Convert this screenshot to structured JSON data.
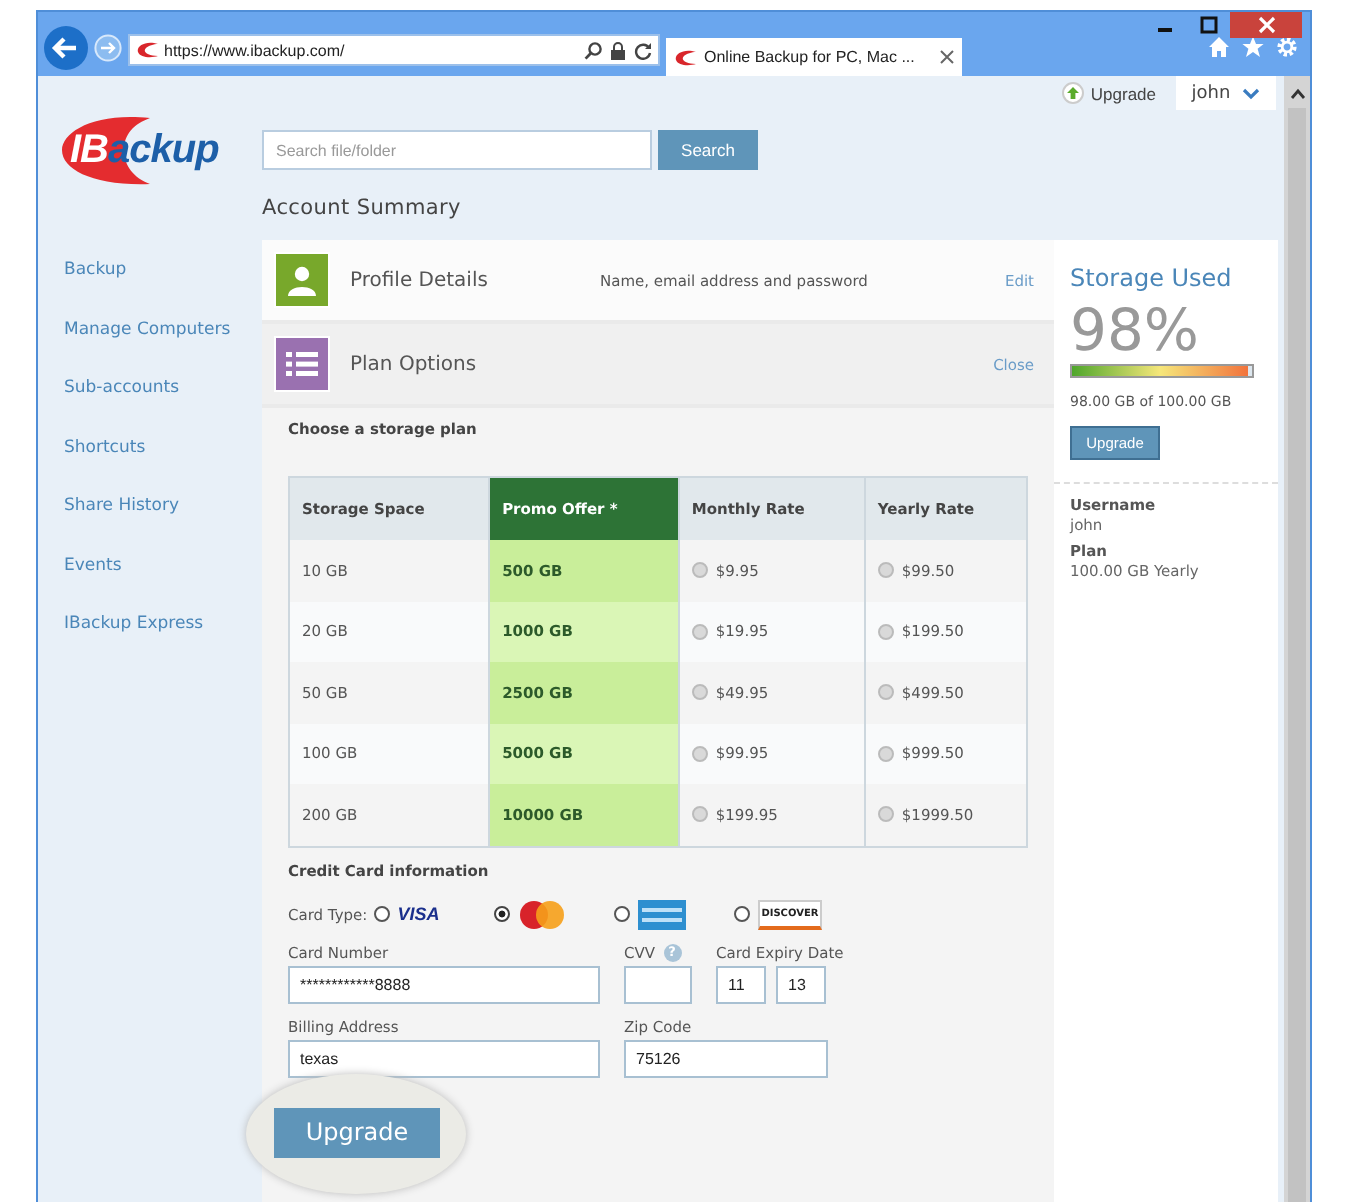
{
  "browser": {
    "address": "https://www.ibackup.com/",
    "tabs": [
      {
        "label": "Online Backup for PC, Mac ...",
        "selected": true
      }
    ]
  },
  "header": {
    "upgrade_link": "Upgrade",
    "user_menu": "john",
    "logo": {
      "prefix": "IB",
      "rest": "ackup"
    },
    "search": {
      "placeholder": "Search file/folder",
      "button": "Search"
    },
    "page_title": "Account Summary"
  },
  "sidebar": {
    "items": [
      {
        "label": "Backup"
      },
      {
        "label": "Manage Computers"
      },
      {
        "label": "Sub-accounts"
      },
      {
        "label": "Shortcuts"
      },
      {
        "label": "Share History"
      },
      {
        "label": "Events"
      },
      {
        "label": "IBackup Express"
      }
    ]
  },
  "sections": [
    {
      "kind": "profile",
      "title": "Profile Details",
      "description": "Name, email address and password",
      "action": "Edit"
    },
    {
      "kind": "plan",
      "title": "Plan Options",
      "action": "Close"
    }
  ],
  "plan": {
    "heading": "Choose a storage plan",
    "columns": [
      "Storage Space",
      "Promo Offer *",
      "Monthly Rate",
      "Yearly Rate"
    ],
    "rows": [
      {
        "space": "10 GB",
        "promo": "500 GB",
        "monthly": {
          "price": "$9.95",
          "selected": false
        },
        "yearly": {
          "price": "$99.50",
          "selected": false
        }
      },
      {
        "space": "20 GB",
        "promo": "1000 GB",
        "monthly": {
          "price": "$19.95",
          "selected": false
        },
        "yearly": {
          "price": "$199.50",
          "selected": false
        }
      },
      {
        "space": "50 GB",
        "promo": "2500 GB",
        "monthly": {
          "price": "$49.95",
          "selected": false
        },
        "yearly": {
          "price": "$499.50",
          "selected": false
        }
      },
      {
        "space": "100 GB",
        "promo": "5000 GB",
        "monthly": {
          "price": "$99.95",
          "selected": false
        },
        "yearly": {
          "price": "$999.50",
          "selected": false
        }
      },
      {
        "space": "200 GB",
        "promo": "10000 GB",
        "monthly": {
          "price": "$199.95",
          "selected": false
        },
        "yearly": {
          "price": "$1999.50",
          "selected": false
        }
      }
    ]
  },
  "credit_card": {
    "heading": "Credit Card information",
    "card_type_label": "Card Type:",
    "card_types": [
      {
        "kind": "visa",
        "label": "VISA",
        "selected": false
      },
      {
        "kind": "mastercard",
        "selected": true
      },
      {
        "kind": "amex",
        "selected": false
      },
      {
        "kind": "discover",
        "label": "DISCOVER",
        "selected": false
      }
    ],
    "card_number": {
      "label": "Card Number",
      "value": "************8888"
    },
    "cvv": {
      "label": "CVV",
      "help": "?"
    },
    "expiry": {
      "label": "Card Expiry Date",
      "month": "11",
      "year": "13"
    },
    "billing_address": {
      "label": "Billing Address",
      "value": "texas"
    },
    "zip": {
      "label": "Zip Code",
      "value": "75126"
    },
    "submit": "Upgrade"
  },
  "storage": {
    "title": "Storage Used",
    "percent": "98%",
    "level": 0.98,
    "detail": "98.00 GB of 100.00 GB",
    "button": "Upgrade",
    "username_label": "Username",
    "username": "john",
    "plan_label": "Plan",
    "plan_value": "100.00 GB Yearly"
  }
}
